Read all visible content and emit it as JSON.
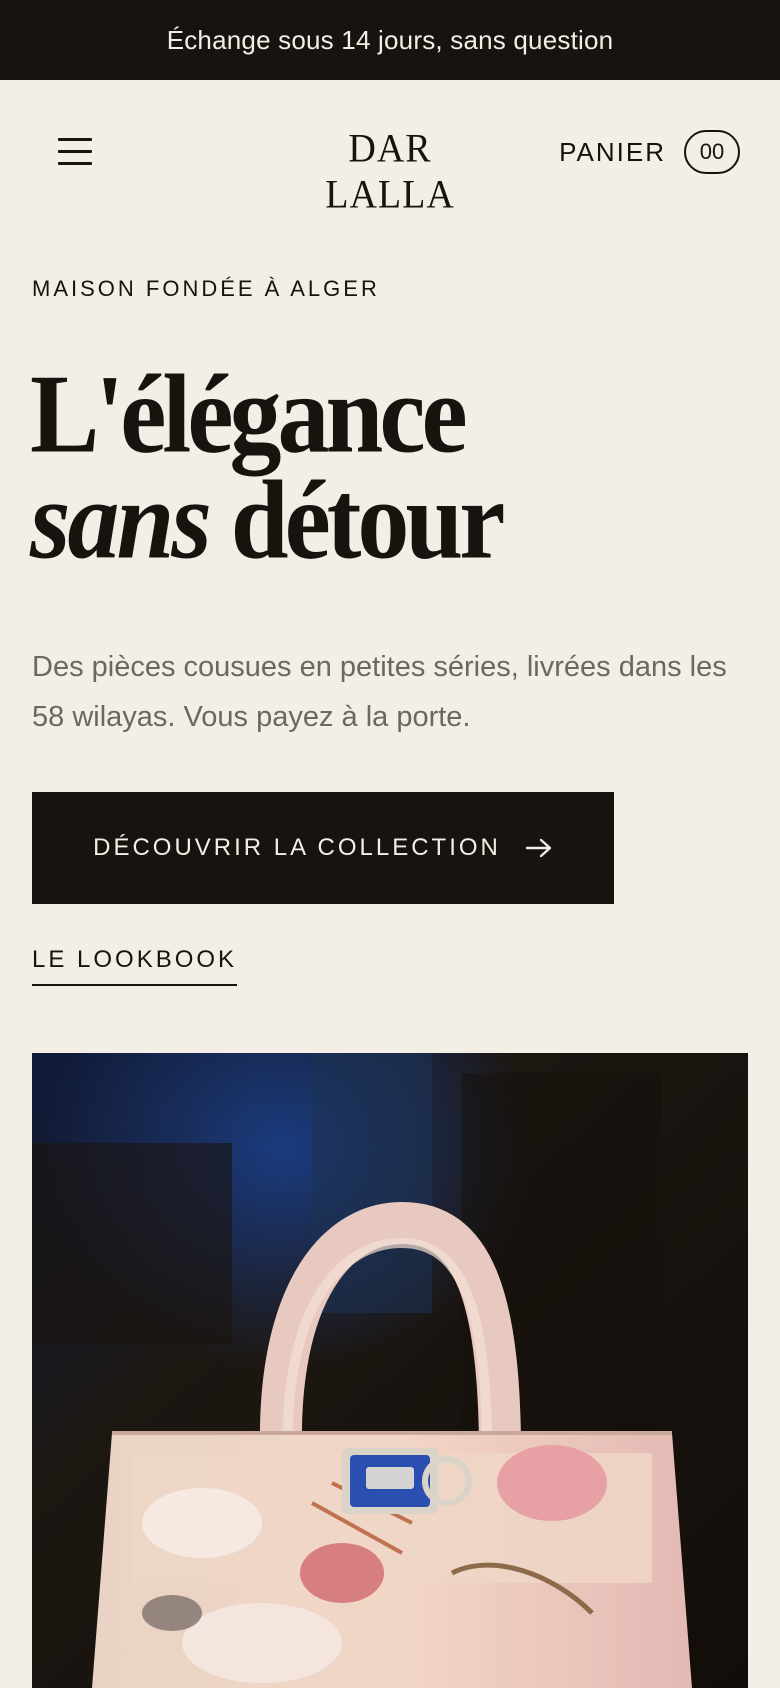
{
  "announcement": {
    "text": "Échange sous 14 jours, sans question"
  },
  "header": {
    "menu_icon": "hamburger-menu-icon",
    "logo": "DAR LALLA",
    "cart_label": "PANIER",
    "cart_count": "00"
  },
  "hero": {
    "eyebrow": "MAISON FONDÉE À ALGER",
    "headline_line1": "L'élégance",
    "headline_italic": "sans",
    "headline_line2_rest": "détour",
    "subtitle": "Des pièces cousues en petites séries, livrées dans les 58 wilayas. Vous payez à la porte.",
    "cta_label": "DÉCOUVRIR LA COLLECTION",
    "cta_icon": "arrow-right-icon",
    "secondary_link": "LE LOOKBOOK"
  },
  "colors": {
    "background": "#f3efe7",
    "ink": "#17130f",
    "muted_text": "#6e6760"
  },
  "image": {
    "subject": "floral-print-handbag-photo"
  }
}
